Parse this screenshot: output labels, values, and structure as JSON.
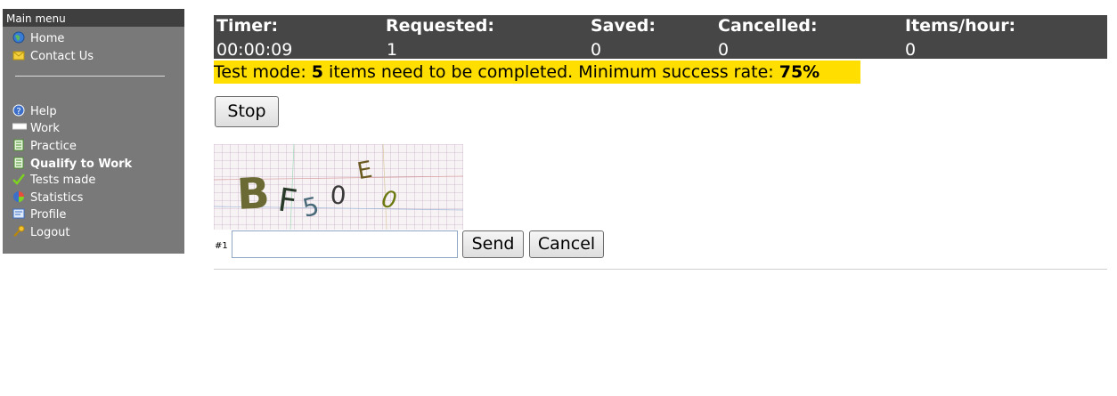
{
  "sidebar": {
    "title": "Main menu",
    "top_items": [
      {
        "label": "Home",
        "icon": "globe-icon"
      },
      {
        "label": "Contact Us",
        "icon": "envelope-icon"
      }
    ],
    "items": [
      {
        "label": "Help",
        "icon": "help-icon"
      },
      {
        "label": "Work",
        "icon": "work-icon"
      },
      {
        "label": "Practice",
        "icon": "document-icon"
      },
      {
        "label": "Qualify to Work",
        "icon": "document-icon"
      },
      {
        "label": "Tests made",
        "icon": "checkmark-icon"
      },
      {
        "label": "Statistics",
        "icon": "pie-chart-icon"
      },
      {
        "label": "Profile",
        "icon": "profile-icon"
      },
      {
        "label": "Logout",
        "icon": "key-icon"
      }
    ],
    "active_item": "Qualify to Work"
  },
  "stats": {
    "timer_label": "Timer:",
    "timer_value": "00:00:09",
    "requested_label": "Requested:",
    "requested_value": "1",
    "saved_label": "Saved:",
    "saved_value": "0",
    "cancelled_label": "Cancelled:",
    "cancelled_value": "0",
    "items_per_hour_label": "Items/hour:",
    "items_per_hour_value": "0"
  },
  "banner": {
    "part1": "Test mode: ",
    "items_count": "5",
    "part2": " items need to be completed. Minimum success rate: ",
    "rate": "75%"
  },
  "controls": {
    "stop_label": "Stop",
    "send_label": "Send",
    "cancel_label": "Cancel",
    "item_number": "#1",
    "answer_value": "",
    "answer_placeholder": ""
  },
  "captcha": {
    "characters": [
      "B",
      "F",
      "5",
      "0",
      "E",
      "0"
    ]
  },
  "colors": {
    "sidebar_bg": "#797979",
    "sidebar_title_bg": "#3f3f3f",
    "stats_bg": "#464646",
    "banner_bg": "#ffde00"
  }
}
